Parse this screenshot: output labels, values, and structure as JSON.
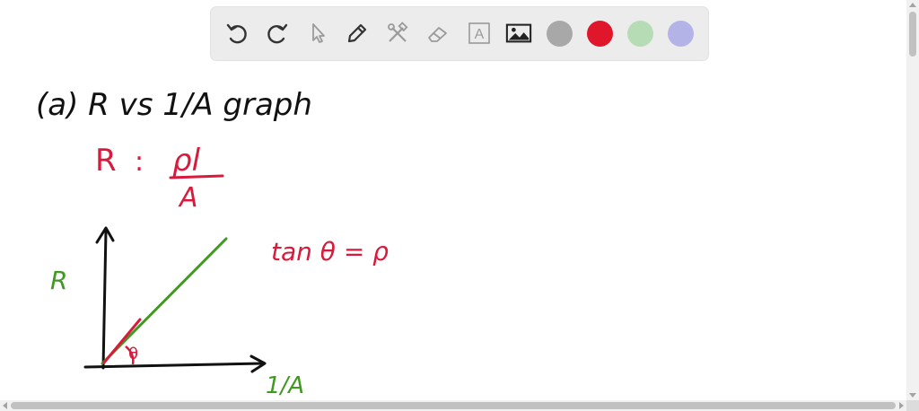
{
  "toolbar": {
    "tools": [
      {
        "name": "undo",
        "icon": "undo-icon"
      },
      {
        "name": "redo",
        "icon": "redo-icon"
      },
      {
        "name": "select",
        "icon": "pointer-icon"
      },
      {
        "name": "pen",
        "icon": "pen-icon"
      },
      {
        "name": "tools",
        "icon": "tools-icon"
      },
      {
        "name": "eraser",
        "icon": "eraser-icon"
      },
      {
        "name": "text",
        "icon": "text-box-icon",
        "label": "A"
      },
      {
        "name": "image",
        "icon": "image-icon"
      }
    ],
    "colors": [
      "#a8a8a8",
      "#e0162b",
      "#b5dcb5",
      "#b3b3e8"
    ]
  },
  "notes": {
    "line1": "(a) R vs 1/A graph",
    "formula_lhs": "R",
    "formula_eq": ":",
    "formula_num": "ρl",
    "formula_den": "A",
    "y_axis_label": "R",
    "x_axis_label": "1/A",
    "angle_label": "θ",
    "tan_eq": "tan θ = ρ",
    "ink_colors": {
      "black": "#111111",
      "red": "#d81b3c",
      "green": "#3f9a1f"
    }
  }
}
